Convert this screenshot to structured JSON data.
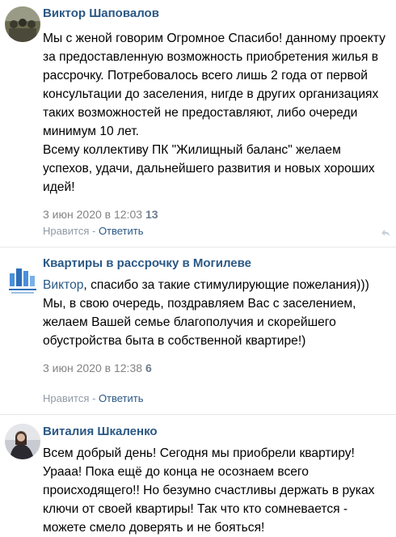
{
  "comments": [
    {
      "author": "Виктор Шаповалов",
      "mention": "",
      "paragraphs": [
        "Мы с женой говорим Огромное Спасибо! данному проекту за предоставленную возможность приобретения жилья в рассрочку. Потребовалось всего лишь 2 года от первой консультации до заселения, нигде в других организациях таких возможностей не предоставляют, либо очереди минимум 10 лет.",
        "Всему коллективу ПК \"Жилищный баланс\" желаем успехов, удачи, дальнейшего развития и новых хороших идей!"
      ],
      "date": "3 июн 2020 в 12:03",
      "likes": "13",
      "like_label": "Нравится",
      "separator": " - ",
      "reply_label": "Ответить"
    },
    {
      "author": "Квартиры в рассрочку в Могилеве",
      "mention": "Виктор",
      "paragraphs": [
        ", спасибо за такие стимулирующие пожелания))) Мы, в свою очередь, поздравляем Вас с заселением, желаем Вашей семье благополучия и скорейшего обустройства быта в собственной квартире!)"
      ],
      "date": "3 июн 2020 в 12:38",
      "likes": "6",
      "like_label": "Нравится",
      "separator": " - ",
      "reply_label": "Ответить"
    },
    {
      "author": "Виталия Шкаленко",
      "mention": "",
      "paragraphs": [
        "Всем добрый день! Сегодня мы приобрели квартиру! Урааа! Пока ещё до конца не осознаем всего происходящего!! Но безумно счастливы держать в руках ключи от своей квартиры! Так что кто сомневается - можете смело доверять и не бояться!"
      ]
    }
  ],
  "icons": {
    "corner": "reply-arrow-icon",
    "logo": "building-logo-icon"
  },
  "colors": {
    "link": "#2a5885",
    "meta": "#828282",
    "divider": "#e7e8ec"
  }
}
